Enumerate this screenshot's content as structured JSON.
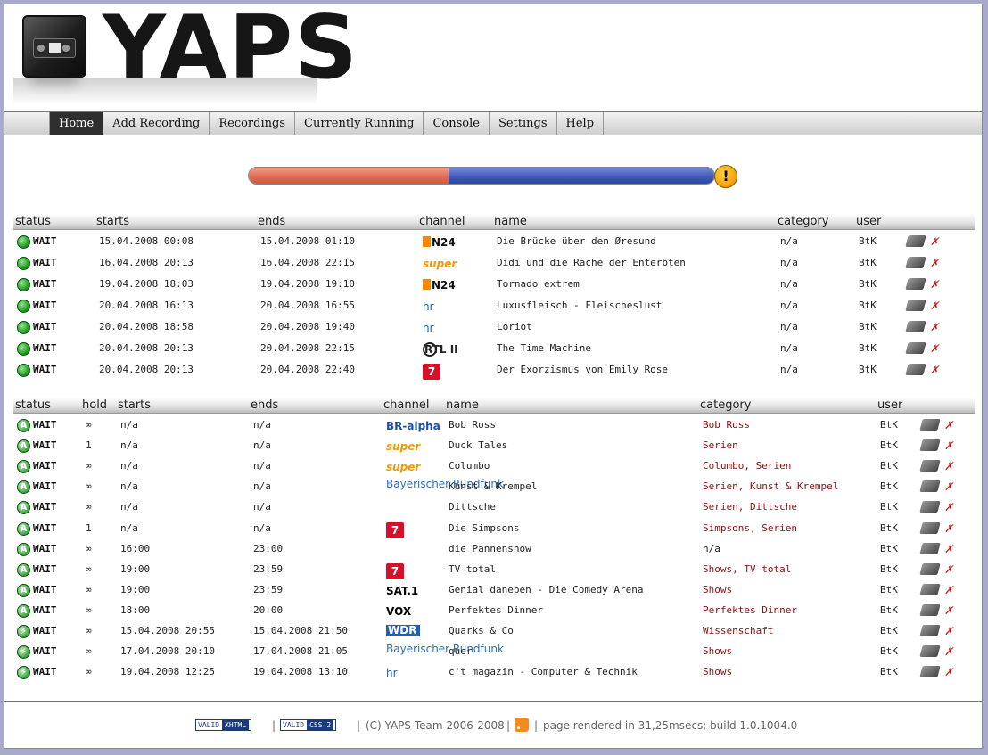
{
  "app": {
    "logo_text": "YAPS"
  },
  "nav": [
    "Home",
    "Add Recording",
    "Recordings",
    "Currently Running",
    "Console",
    "Settings",
    "Help"
  ],
  "progress": {
    "fill_fraction": 0.43,
    "warning": "!"
  },
  "table1": {
    "headers": [
      "status",
      "starts",
      "ends",
      "channel",
      "name",
      "category",
      "user"
    ],
    "rows": [
      {
        "status": "WAIT",
        "starts": "15.04.2008 00:08",
        "ends": "15.04.2008 01:10",
        "channel": "N24",
        "name": "Die Brücke über den Øresund",
        "category": "n/a",
        "user": "BtK"
      },
      {
        "status": "WAIT",
        "starts": "16.04.2008 20:13",
        "ends": "16.04.2008 22:15",
        "channel": "super",
        "name": "Didi und die Rache der Enterbten",
        "category": "n/a",
        "user": "BtK"
      },
      {
        "status": "WAIT",
        "starts": "19.04.2008 18:03",
        "ends": "19.04.2008 19:10",
        "channel": "N24",
        "name": "Tornado extrem",
        "category": "n/a",
        "user": "BtK"
      },
      {
        "status": "WAIT",
        "starts": "20.04.2008 16:13",
        "ends": "20.04.2008 16:55",
        "channel": "hr",
        "name": "Luxusfleisch - Fleischeslust",
        "category": "n/a",
        "user": "BtK"
      },
      {
        "status": "WAIT",
        "starts": "20.04.2008 18:58",
        "ends": "20.04.2008 19:40",
        "channel": "hr",
        "name": "Loriot",
        "category": "n/a",
        "user": "BtK"
      },
      {
        "status": "WAIT",
        "starts": "20.04.2008 20:13",
        "ends": "20.04.2008 22:15",
        "channel": "RTL II",
        "name": "The Time Machine",
        "category": "n/a",
        "user": "BtK"
      },
      {
        "status": "WAIT",
        "starts": "20.04.2008 20:13",
        "ends": "20.04.2008 22:40",
        "channel": "7",
        "name": "Der Exorzismus von Emily Rose",
        "category": "n/a",
        "user": "BtK"
      }
    ]
  },
  "table2": {
    "headers": [
      "status",
      "hold",
      "starts",
      "ends",
      "channel",
      "name",
      "category",
      "user"
    ],
    "rows": [
      {
        "icon": "A",
        "status": "WAIT",
        "hold": "∞",
        "starts": "n/a",
        "ends": "n/a",
        "channel": "BR-alpha",
        "name": "Bob Ross",
        "category": "Bob Ross",
        "user": "BtK"
      },
      {
        "icon": "A",
        "status": "WAIT",
        "hold": "1",
        "starts": "n/a",
        "ends": "n/a",
        "channel": "super",
        "name": "Duck Tales",
        "category": "Serien",
        "user": "BtK"
      },
      {
        "icon": "A",
        "status": "WAIT",
        "hold": "∞",
        "starts": "n/a",
        "ends": "n/a",
        "channel": "super",
        "name": "Columbo",
        "category": "Columbo, Serien",
        "user": "BtK"
      },
      {
        "icon": "A",
        "status": "WAIT",
        "hold": "∞",
        "starts": "n/a",
        "ends": "n/a",
        "channel": "Bayerischer Rundfunk",
        "name": "Kunst & Krempel",
        "category": "Serien, Kunst & Krempel",
        "user": "BtK"
      },
      {
        "icon": "A",
        "status": "WAIT",
        "hold": "∞",
        "starts": "n/a",
        "ends": "n/a",
        "channel": "",
        "name": "Dittsche",
        "category": "Serien, Dittsche",
        "user": "BtK"
      },
      {
        "icon": "A",
        "status": "WAIT",
        "hold": "1",
        "starts": "n/a",
        "ends": "n/a",
        "channel": "7",
        "name": "Die Simpsons",
        "category": "Simpsons, Serien",
        "user": "BtK"
      },
      {
        "icon": "A",
        "status": "WAIT",
        "hold": "∞",
        "starts": "16:00",
        "ends": "23:00",
        "channel": "",
        "name": "die Pannenshow",
        "category": "n/a",
        "user": "BtK",
        "category_plain": true
      },
      {
        "icon": "A",
        "status": "WAIT",
        "hold": "∞",
        "starts": "19:00",
        "ends": "23:59",
        "channel": "7",
        "name": "TV total",
        "category": "Shows, TV total",
        "user": "BtK"
      },
      {
        "icon": "A",
        "status": "WAIT",
        "hold": "∞",
        "starts": "19:00",
        "ends": "23:59",
        "channel": "SAT.1",
        "name": "Genial daneben - Die Comedy Arena",
        "category": "Shows",
        "user": "BtK"
      },
      {
        "icon": "A",
        "status": "WAIT",
        "hold": "∞",
        "starts": "18:00",
        "ends": "20:00",
        "channel": "VOX",
        "name": "Perfektes Dinner",
        "category": "Perfektes Dinner",
        "user": "BtK"
      },
      {
        "icon": "⚡",
        "status": "WAIT",
        "hold": "∞",
        "starts": "15.04.2008 20:55",
        "ends": "15.04.2008 21:50",
        "channel": "WDR",
        "name": "Quarks & Co",
        "category": "Wissenschaft",
        "user": "BtK"
      },
      {
        "icon": "⚡",
        "status": "WAIT",
        "hold": "∞",
        "starts": "17.04.2008 20:10",
        "ends": "17.04.2008 21:05",
        "channel": "Bayerischer Rundfunk",
        "name": "quer",
        "category": "Shows",
        "user": "BtK"
      },
      {
        "icon": "⚡",
        "status": "WAIT",
        "hold": "∞",
        "starts": "19.04.2008 12:25",
        "ends": "19.04.2008 13:10",
        "channel": "hr",
        "name": "c't magazin - Computer & Technik",
        "category": "Shows",
        "user": "BtK"
      }
    ]
  },
  "footer": {
    "xhtml_badge": [
      "VALID",
      "XHTML"
    ],
    "css_badge": [
      "VALID",
      "CSS 2"
    ],
    "sep": "|",
    "copyright": "(C) YAPS Team 2006-2008",
    "rendered": "page rendered in 31,25msecs; build 1.0.1004.0"
  },
  "colors": {
    "category_link": "#8b1010",
    "nav_active": "#2f2f2f",
    "progress_done": "#e06a50",
    "progress_rest": "#3f58b8"
  }
}
